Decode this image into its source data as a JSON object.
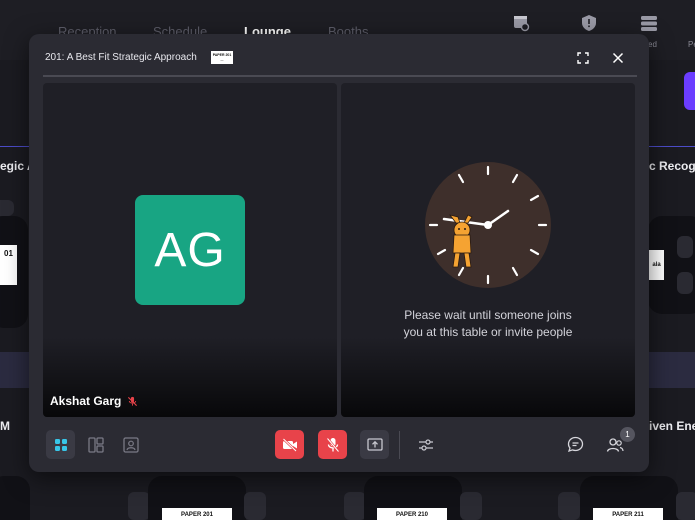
{
  "background": {
    "tabs": [
      "Reception",
      "Schedule",
      "Lounge",
      "Booths"
    ],
    "active_tab": "Lounge",
    "top_icon_labels": [
      "ed",
      "Pe"
    ],
    "row_texts": [
      "egic A",
      "c Recogn",
      "M",
      "iven Ene"
    ],
    "paper_labels": [
      "01",
      "ala",
      "PAPER 201",
      "PAPER 210",
      "PAPER 211"
    ]
  },
  "modal": {
    "title": "201: A Best Fit Strategic Approach",
    "title_badge": "PAPER 201 ...",
    "participant": {
      "initials": "AG",
      "name": "Akshat Garg",
      "muted": true,
      "avatar_color": "#18a583"
    },
    "empty_seat": {
      "line1": "Please wait until someone joins",
      "line2": "you at this table or invite people"
    },
    "participants_count": "1"
  },
  "colors": {
    "accent_teal": "#38c6e8",
    "danger": "#e8434a",
    "mute_icon": "#e8434a"
  }
}
